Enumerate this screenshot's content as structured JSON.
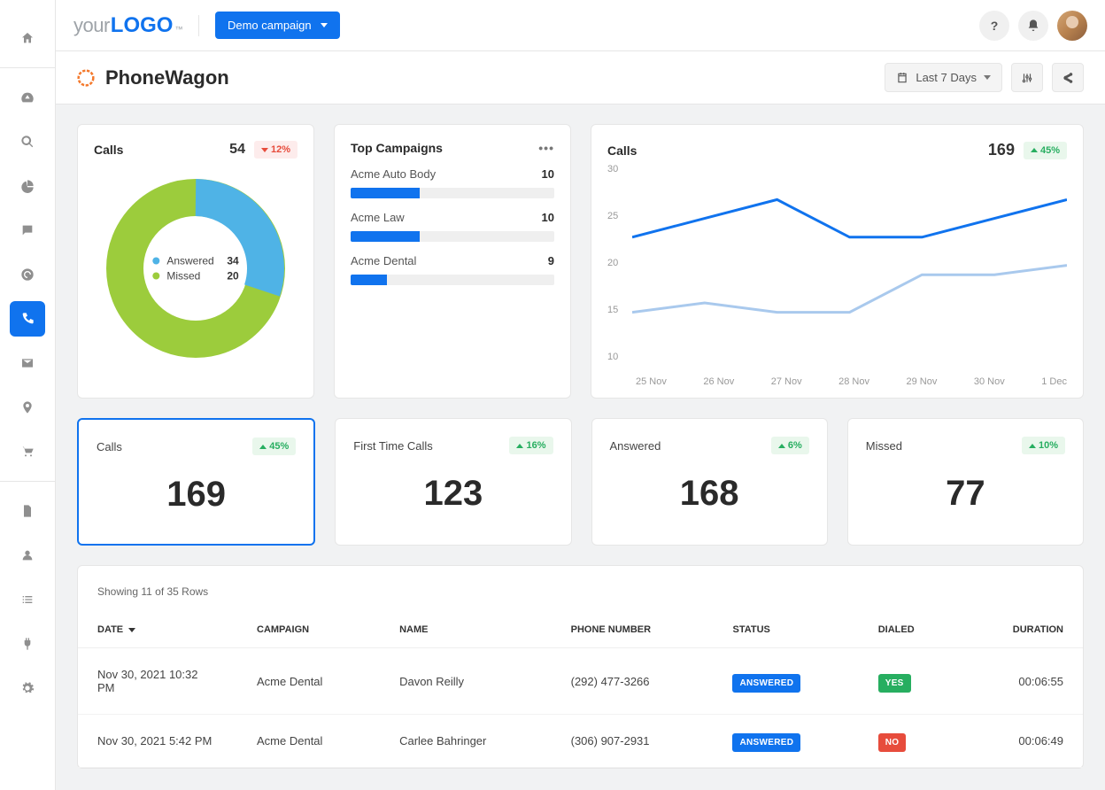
{
  "header": {
    "logo_part1": "your",
    "logo_part2": "LOGO",
    "logo_tm": "™",
    "campaign_button": "Demo campaign"
  },
  "page": {
    "title": "PhoneWagon",
    "date_range": "Last 7 Days"
  },
  "calls_card": {
    "title": "Calls",
    "total": "54",
    "change": "12%",
    "answered_label": "Answered",
    "answered_value": "34",
    "missed_label": "Missed",
    "missed_value": "20"
  },
  "campaigns_card": {
    "title": "Top Campaigns",
    "items": [
      {
        "name": "Acme Auto Body",
        "value": "10",
        "pct": 34
      },
      {
        "name": "Acme Law",
        "value": "10",
        "pct": 34
      },
      {
        "name": "Acme Dental",
        "value": "9",
        "pct": 18
      }
    ]
  },
  "chart_card": {
    "title": "Calls",
    "total": "169",
    "change": "45%"
  },
  "chart_data": {
    "type": "line",
    "title": "Calls",
    "x": [
      "25 Nov",
      "26 Nov",
      "27 Nov",
      "28 Nov",
      "29 Nov",
      "30 Nov",
      "1 Dec"
    ],
    "ylim": [
      10,
      30
    ],
    "series": [
      {
        "name": "primary",
        "color": "#1073ee",
        "values": [
          22,
          24,
          26,
          22,
          22,
          24,
          26
        ]
      },
      {
        "name": "secondary",
        "color": "#a9c9ed",
        "values": [
          14,
          15,
          14,
          14,
          18,
          18,
          19
        ]
      }
    ]
  },
  "stat_cards": [
    {
      "title": "Calls",
      "value": "169",
      "change": "45%",
      "selected": true
    },
    {
      "title": "First Time Calls",
      "value": "123",
      "change": "16%",
      "selected": false
    },
    {
      "title": "Answered",
      "value": "168",
      "change": "6%",
      "selected": false
    },
    {
      "title": "Missed",
      "value": "77",
      "change": "10%",
      "selected": false
    }
  ],
  "table": {
    "showing": "Showing 11 of 35 Rows",
    "headers": {
      "date": "DATE",
      "campaign": "CAMPAIGN",
      "name": "NAME",
      "phone": "PHONE NUMBER",
      "status": "STATUS",
      "dialed": "DIALED",
      "duration": "DURATION"
    },
    "rows": [
      {
        "date": "Nov 30, 2021 10:32 PM",
        "campaign": "Acme Dental",
        "name": "Davon Reilly",
        "phone": "(292) 477-3266",
        "status": "ANSWERED",
        "dialed": "YES",
        "dialed_class": "yes",
        "duration": "00:06:55"
      },
      {
        "date": "Nov 30, 2021 5:42 PM",
        "campaign": "Acme Dental",
        "name": "Carlee Bahringer",
        "phone": "(306) 907-2931",
        "status": "ANSWERED",
        "dialed": "NO",
        "dialed_class": "no",
        "duration": "00:06:49"
      }
    ]
  },
  "colors": {
    "primary": "#1073ee",
    "green": "#9ccc3c",
    "blue_light": "#4fb3e6"
  }
}
